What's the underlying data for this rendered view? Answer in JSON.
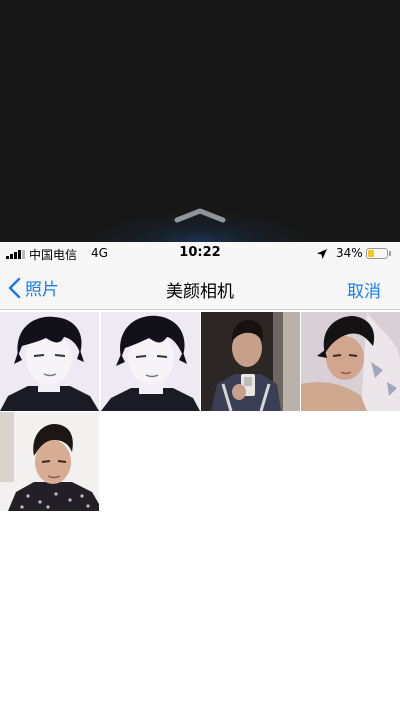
{
  "status_bar": {
    "carrier": "中国电信",
    "network": "4G",
    "time": "10:22",
    "battery_percent_text": "34%",
    "battery_level": 0.34,
    "battery_color": "#f5c518"
  },
  "nav": {
    "back_label": "照片",
    "title": "美颜相机",
    "cancel_label": "取消",
    "accent_color": "#1a7ef2"
  },
  "photos": [
    {
      "id": "photo-1",
      "style": "bw-sketch"
    },
    {
      "id": "photo-2",
      "style": "bw-sketch"
    },
    {
      "id": "photo-3",
      "style": "mirror-selfie"
    },
    {
      "id": "photo-4",
      "style": "lying-selfie"
    },
    {
      "id": "photo-5",
      "style": "selfie"
    }
  ]
}
